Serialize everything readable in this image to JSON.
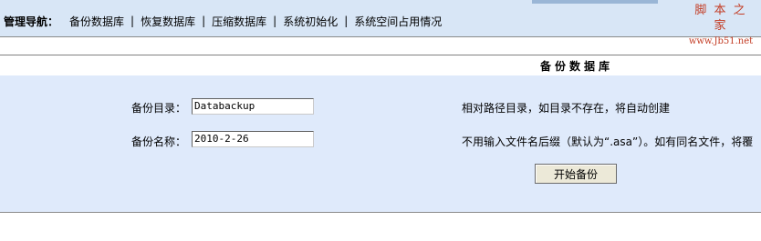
{
  "nav": {
    "title": "管理导航：",
    "items": [
      "备份数据库",
      "恢复数据库",
      "压缩数据库",
      "系统初始化",
      "系统空间占用情况"
    ],
    "separator": "|"
  },
  "watermark": {
    "title": "脚 本 之 家",
    "url": "www.Jb51.net"
  },
  "section": {
    "title": "备份数据库"
  },
  "form": {
    "dir_label": "备份目录：",
    "dir_value": "Databackup",
    "dir_hint": "相对路径目录，如目录不存在，将自动创建",
    "name_label": "备份名称：",
    "name_value": "2010-2-26",
    "name_hint": "不用输入文件名后缀（默认为“.asa”）。如有同名文件，将覆",
    "submit_label": "开始备份"
  },
  "colors": {
    "topbar": "#d8e6f6",
    "panel": "#dfeafb",
    "watermark": "#c33c24"
  }
}
